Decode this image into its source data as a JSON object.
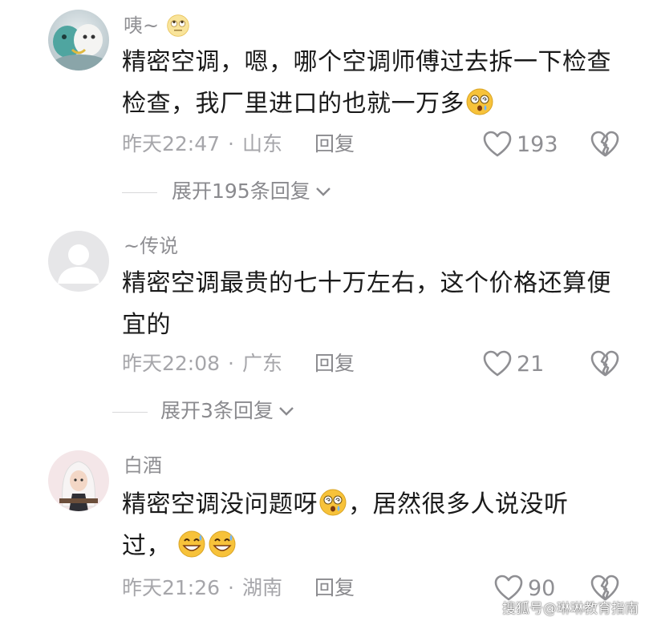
{
  "comments": [
    {
      "username": "咦~",
      "text_1": "精密空调，嗯，哪个空调师傅过去拆一下检查",
      "text_2": "检查，我厂里进口的也就一万多",
      "time": "昨天22:47",
      "location": "山东",
      "reply_label": "回复",
      "likes": "193",
      "expand_label": "展开195条回复",
      "avatar_icon": "dragon-figurine-avatar"
    },
    {
      "username": "~传说",
      "text_1": "精密空调最贵的七十万左右，这个价格还算便",
      "text_2": "宜的",
      "time": "昨天22:08",
      "location": "广东",
      "reply_label": "回复",
      "likes": "21",
      "expand_label": "展开3条回复",
      "avatar_icon": "default-user-avatar"
    },
    {
      "username": "白酒",
      "text_1": "精密空调没问题呀",
      "text_1b": "，居然很多人说没听",
      "text_2": "过，",
      "time": "昨天21:26",
      "location": "湖南",
      "reply_label": "回复",
      "likes": "90",
      "avatar_icon": "white-hair-character-avatar"
    }
  ],
  "watermark": "搜狐号@琳琳教育指南",
  "colors": {
    "text": "#1a1a1a",
    "secondary": "#8f8f93",
    "meta": "#a6a6aa",
    "emoji": "#f7c23a"
  }
}
